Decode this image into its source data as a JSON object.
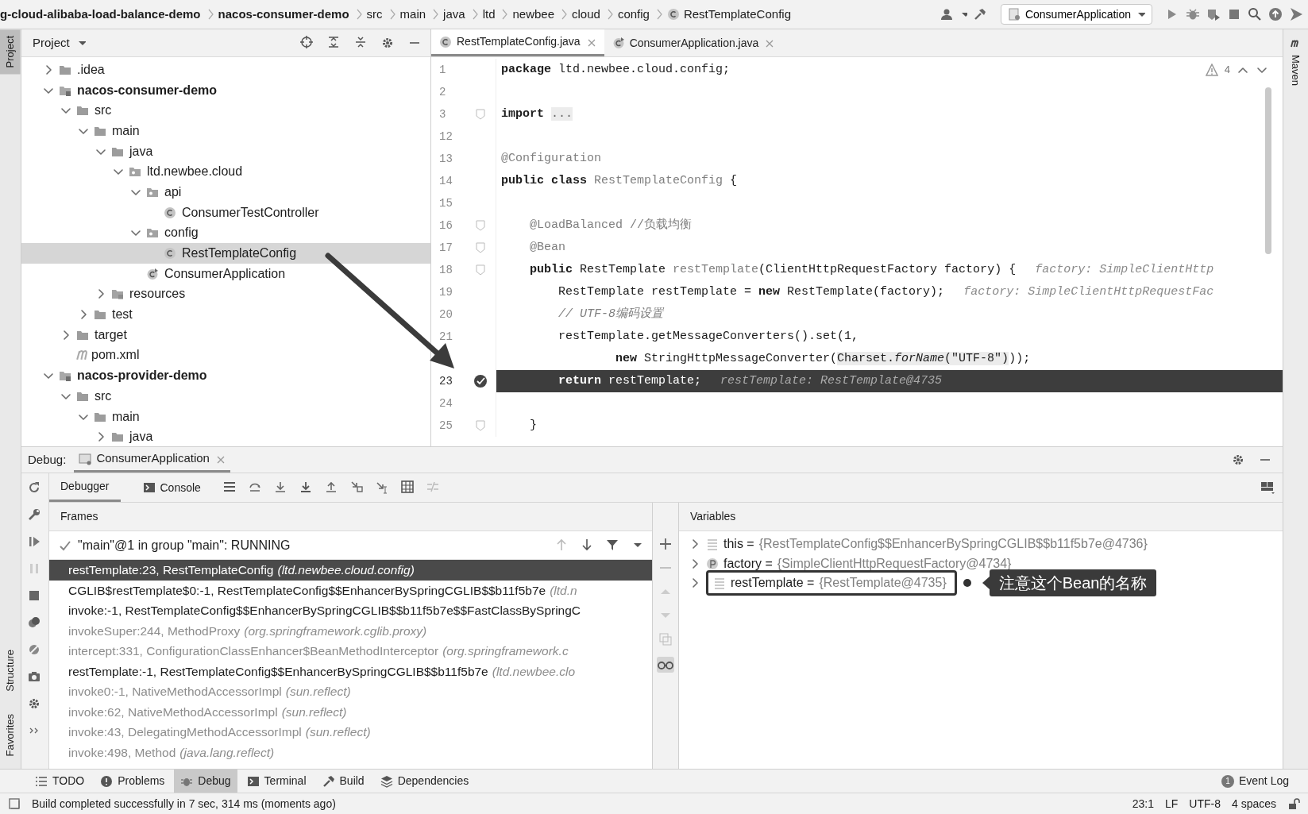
{
  "breadcrumbs": [
    {
      "label": "g-cloud-alibaba-load-balance-demo",
      "bold": true
    },
    {
      "label": "nacos-consumer-demo",
      "bold": true
    },
    {
      "label": "src",
      "bold": false
    },
    {
      "label": "main",
      "bold": false
    },
    {
      "label": "java",
      "bold": false
    },
    {
      "label": "ltd",
      "bold": false
    },
    {
      "label": "newbee",
      "bold": false
    },
    {
      "label": "cloud",
      "bold": false
    },
    {
      "label": "config",
      "bold": false
    },
    {
      "label": "RestTemplateConfig",
      "bold": false,
      "kind": "class"
    }
  ],
  "run_config": "ConsumerApplication",
  "left_tabs_top": [
    {
      "label": "Project",
      "selected": true
    }
  ],
  "left_tabs_bottom": [
    {
      "label": "Structure",
      "selected": false
    },
    {
      "label": "Favorites",
      "selected": false
    }
  ],
  "right_tabs": [
    {
      "label": "Maven",
      "selected": false
    }
  ],
  "project": {
    "title": "Project",
    "tree": [
      {
        "label": ".idea",
        "kind": "folder",
        "bold": false,
        "expanded": false,
        "selected": false
      },
      {
        "label": "nacos-consumer-demo",
        "kind": "module",
        "bold": true,
        "expanded": true,
        "selected": false,
        "children": [
          {
            "label": "src",
            "kind": "folder",
            "bold": false,
            "expanded": true,
            "selected": false,
            "children": [
              {
                "label": "main",
                "kind": "folder",
                "bold": false,
                "expanded": true,
                "selected": false,
                "children": [
                  {
                    "label": "java",
                    "kind": "folder",
                    "bold": false,
                    "expanded": true,
                    "selected": false,
                    "children": [
                      {
                        "label": "ltd.newbee.cloud",
                        "kind": "package",
                        "bold": false,
                        "expanded": true,
                        "selected": false,
                        "children": [
                          {
                            "label": "api",
                            "kind": "package",
                            "bold": false,
                            "expanded": true,
                            "selected": false,
                            "children": [
                              {
                                "label": "ConsumerTestController",
                                "kind": "class",
                                "bold": false,
                                "selected": false
                              }
                            ]
                          },
                          {
                            "label": "config",
                            "kind": "package",
                            "bold": false,
                            "expanded": true,
                            "selected": false,
                            "children": [
                              {
                                "label": "RestTemplateConfig",
                                "kind": "class",
                                "bold": false,
                                "selected": true
                              }
                            ]
                          },
                          {
                            "label": "ConsumerApplication",
                            "kind": "app",
                            "bold": false,
                            "selected": false
                          }
                        ]
                      }
                    ]
                  },
                  {
                    "label": "resources",
                    "kind": "resources",
                    "bold": false,
                    "expanded": false,
                    "selected": false
                  }
                ]
              },
              {
                "label": "test",
                "kind": "folder",
                "bold": false,
                "expanded": false,
                "selected": false
              }
            ]
          },
          {
            "label": "target",
            "kind": "folder",
            "bold": false,
            "expanded": false,
            "selected": false
          },
          {
            "label": "pom.xml",
            "kind": "maven",
            "bold": false,
            "selected": false
          }
        ]
      },
      {
        "label": "nacos-provider-demo",
        "kind": "module",
        "bold": true,
        "expanded": true,
        "selected": false,
        "children": [
          {
            "label": "src",
            "kind": "folder",
            "bold": false,
            "expanded": true,
            "selected": false,
            "children": [
              {
                "label": "main",
                "kind": "folder",
                "bold": false,
                "expanded": true,
                "selected": false,
                "children": [
                  {
                    "label": "java",
                    "kind": "folder",
                    "bold": false,
                    "expanded": false,
                    "selected": false
                  }
                ]
              }
            ]
          }
        ]
      }
    ]
  },
  "editor": {
    "tabs": [
      {
        "label": "RestTemplateConfig.java",
        "selected": true,
        "kind": "class"
      },
      {
        "label": "ConsumerApplication.java",
        "selected": false,
        "kind": "app"
      }
    ],
    "warnings": "4",
    "lines": [
      {
        "number": "1",
        "segments": [
          {
            "text": "package",
            "kind": "kw"
          },
          {
            "text": " ltd.newbee.cloud.config;",
            "kind": "plain"
          }
        ]
      },
      {
        "number": "2"
      },
      {
        "number": "3",
        "fold_marker": true,
        "segments": [
          {
            "text": "import ",
            "kind": "kw"
          },
          {
            "text": "...",
            "kind": "fold"
          }
        ]
      },
      {
        "number": "12"
      },
      {
        "number": "13",
        "segments": [
          {
            "text": "@Configuration",
            "kind": "ann"
          }
        ]
      },
      {
        "number": "14",
        "segments": [
          {
            "text": "public class ",
            "kind": "kw"
          },
          {
            "text": "RestTemplateConfig",
            "kind": "decl"
          },
          {
            "text": " {",
            "kind": "plain"
          }
        ]
      },
      {
        "number": "15"
      },
      {
        "number": "16",
        "fold_marker": true,
        "segments": [
          {
            "text": "    @LoadBalanced",
            "kind": "ann"
          },
          {
            "text": " //负载均衡",
            "kind": "cmt"
          }
        ]
      },
      {
        "number": "17",
        "fold_marker": true,
        "segments": [
          {
            "text": "    @Bean",
            "kind": "ann"
          }
        ]
      },
      {
        "number": "18",
        "fold_marker": true,
        "segments": [
          {
            "text": "    public",
            "kind": "kw"
          },
          {
            "text": " RestTemplate ",
            "kind": "plain"
          },
          {
            "text": "restTemplate",
            "kind": "decl"
          },
          {
            "text": "(ClientHttpRequestFactory factory) {",
            "kind": "plain"
          }
        ],
        "hint": "factory: SimpleClientHttp"
      },
      {
        "number": "19",
        "segments": [
          {
            "text": "        RestTemplate restTemplate = ",
            "kind": "plain"
          },
          {
            "text": "new",
            "kind": "kw"
          },
          {
            "text": " RestTemplate(factory);",
            "kind": "plain"
          }
        ],
        "hint": "factory: SimpleClientHttpRequestFac"
      },
      {
        "number": "20",
        "segments": [
          {
            "text": "        // UTF-8编码设置",
            "kind": "doc"
          }
        ]
      },
      {
        "number": "21",
        "segments": [
          {
            "text": "        restTemplate.getMessageConverters().set(1,",
            "kind": "plain"
          }
        ]
      },
      {
        "segments": [
          {
            "text": "                new",
            "kind": "kw"
          },
          {
            "text": " StringHttpMessageConverter(",
            "kind": "plain"
          },
          {
            "text": "Charset.",
            "kind": "match"
          },
          {
            "text": "forName",
            "kind": "static"
          },
          {
            "text": "(\"UTF-8\")",
            "kind": "match"
          },
          {
            "text": "));",
            "kind": "plain"
          }
        ]
      },
      {
        "number": "23",
        "current": true,
        "breakpoint": true,
        "segments": [
          {
            "text": "        return",
            "kind": "kw"
          },
          {
            "text": " restTemplate;",
            "kind": "plain"
          }
        ],
        "hint": "restTemplate: RestTemplate@4735"
      },
      {
        "number": "24"
      },
      {
        "number": "25",
        "fold_marker": true,
        "segments": [
          {
            "text": "    }",
            "kind": "plain"
          }
        ]
      }
    ]
  },
  "debug": {
    "label": "Debug:",
    "session": "ConsumerApplication",
    "tabs": [
      {
        "label": "Debugger",
        "selected": true
      },
      {
        "label": "Console",
        "selected": false
      }
    ],
    "frames_title": "Frames",
    "thread": "\"main\"@1 in group \"main\": RUNNING",
    "frames": [
      {
        "method": "restTemplate:23, RestTemplateConfig",
        "package": "(ltd.newbee.cloud.config)",
        "library": false,
        "selected": true
      },
      {
        "method": "CGLIB$restTemplate$0:-1, RestTemplateConfig$$EnhancerBySpringCGLIB$$b11f5b7e",
        "package": "(ltd.n",
        "library": false,
        "selected": false
      },
      {
        "method": "invoke:-1, RestTemplateConfig$$EnhancerBySpringCGLIB$$b11f5b7e$$FastClassBySpringC",
        "library": false,
        "selected": false
      },
      {
        "method": "invokeSuper:244, MethodProxy",
        "package": "(org.springframework.cglib.proxy)",
        "library": true,
        "selected": false
      },
      {
        "method": "intercept:331, ConfigurationClassEnhancer$BeanMethodInterceptor",
        "package": "(org.springframework.c",
        "library": true,
        "selected": false
      },
      {
        "method": "restTemplate:-1, RestTemplateConfig$$EnhancerBySpringCGLIB$$b11f5b7e",
        "package": "(ltd.newbee.clo",
        "library": false,
        "selected": false
      },
      {
        "method": "invoke0:-1, NativeMethodAccessorImpl",
        "package": "(sun.reflect)",
        "library": true,
        "selected": false
      },
      {
        "method": "invoke:62, NativeMethodAccessorImpl",
        "package": "(sun.reflect)",
        "library": true,
        "selected": false
      },
      {
        "method": "invoke:43, DelegatingMethodAccessorImpl",
        "package": "(sun.reflect)",
        "library": true,
        "selected": false
      },
      {
        "method": "invoke:498, Method",
        "package": "(java.lang.reflect)",
        "library": true,
        "selected": false
      }
    ],
    "variables_title": "Variables",
    "variables": [
      {
        "label": "this =",
        "value": "{RestTemplateConfig$$EnhancerBySpringCGLIB$$b11f5b7e@4736}",
        "kind": "field"
      },
      {
        "label": "factory =",
        "value": "{SimpleClientHttpRequestFactory@4734}",
        "kind": "param"
      },
      {
        "label": "restTemplate =",
        "value": "{RestTemplate@4735}",
        "kind": "field",
        "callout": "注意这个Bean的名称"
      }
    ]
  },
  "tool_windows": [
    {
      "label": "TODO",
      "selected": false
    },
    {
      "label": "Problems",
      "selected": false
    },
    {
      "label": "Debug",
      "selected": true
    },
    {
      "label": "Terminal",
      "selected": false
    },
    {
      "label": "Build",
      "selected": false
    },
    {
      "label": "Dependencies",
      "selected": false
    }
  ],
  "event_log": {
    "count": "1",
    "label": "Event Log"
  },
  "status": {
    "message": "Build completed successfully in 7 sec, 314 ms (moments ago)",
    "position": "23:1",
    "line_separator": "LF",
    "encoding": "UTF-8",
    "indent": "4 spaces"
  }
}
